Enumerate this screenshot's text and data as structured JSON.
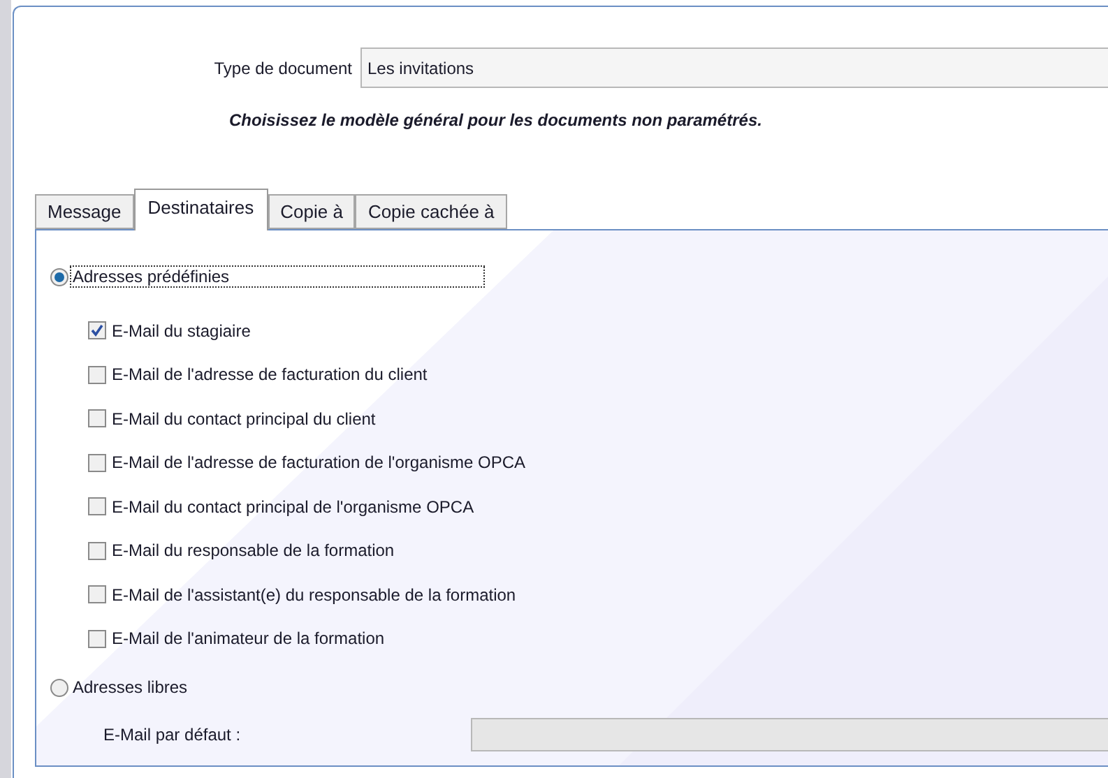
{
  "document_type": {
    "label": "Type de document",
    "value": "Les invitations"
  },
  "instruction": "Choisissez le modèle général pour les documents non paramétrés.",
  "tabs": [
    {
      "label": "Message",
      "selected": false
    },
    {
      "label": "Destinataires",
      "selected": true
    },
    {
      "label": "Copie à",
      "selected": false
    },
    {
      "label": "Copie cachée à",
      "selected": false
    }
  ],
  "predefined": {
    "label": "Adresses prédéfinies",
    "selected": true,
    "focused": true
  },
  "recipients": [
    {
      "label": "E-Mail du stagiaire",
      "checked": true
    },
    {
      "label": "E-Mail de l'adresse de facturation du client",
      "checked": false
    },
    {
      "label": "E-Mail du contact principal du client",
      "checked": false
    },
    {
      "label": "E-Mail de l'adresse de facturation de l'organisme OPCA",
      "checked": false
    },
    {
      "label": "E-Mail du contact principal de l'organisme OPCA",
      "checked": false
    },
    {
      "label": "E-Mail du responsable de la formation",
      "checked": false
    },
    {
      "label": "E-Mail de l'assistant(e) du responsable de la formation",
      "checked": false
    },
    {
      "label": "E-Mail de l'animateur de la formation",
      "checked": false
    }
  ],
  "free": {
    "label": "Adresses libres",
    "selected": false
  },
  "default_email": {
    "label": "E-Mail par défaut :",
    "disabled": true
  }
}
